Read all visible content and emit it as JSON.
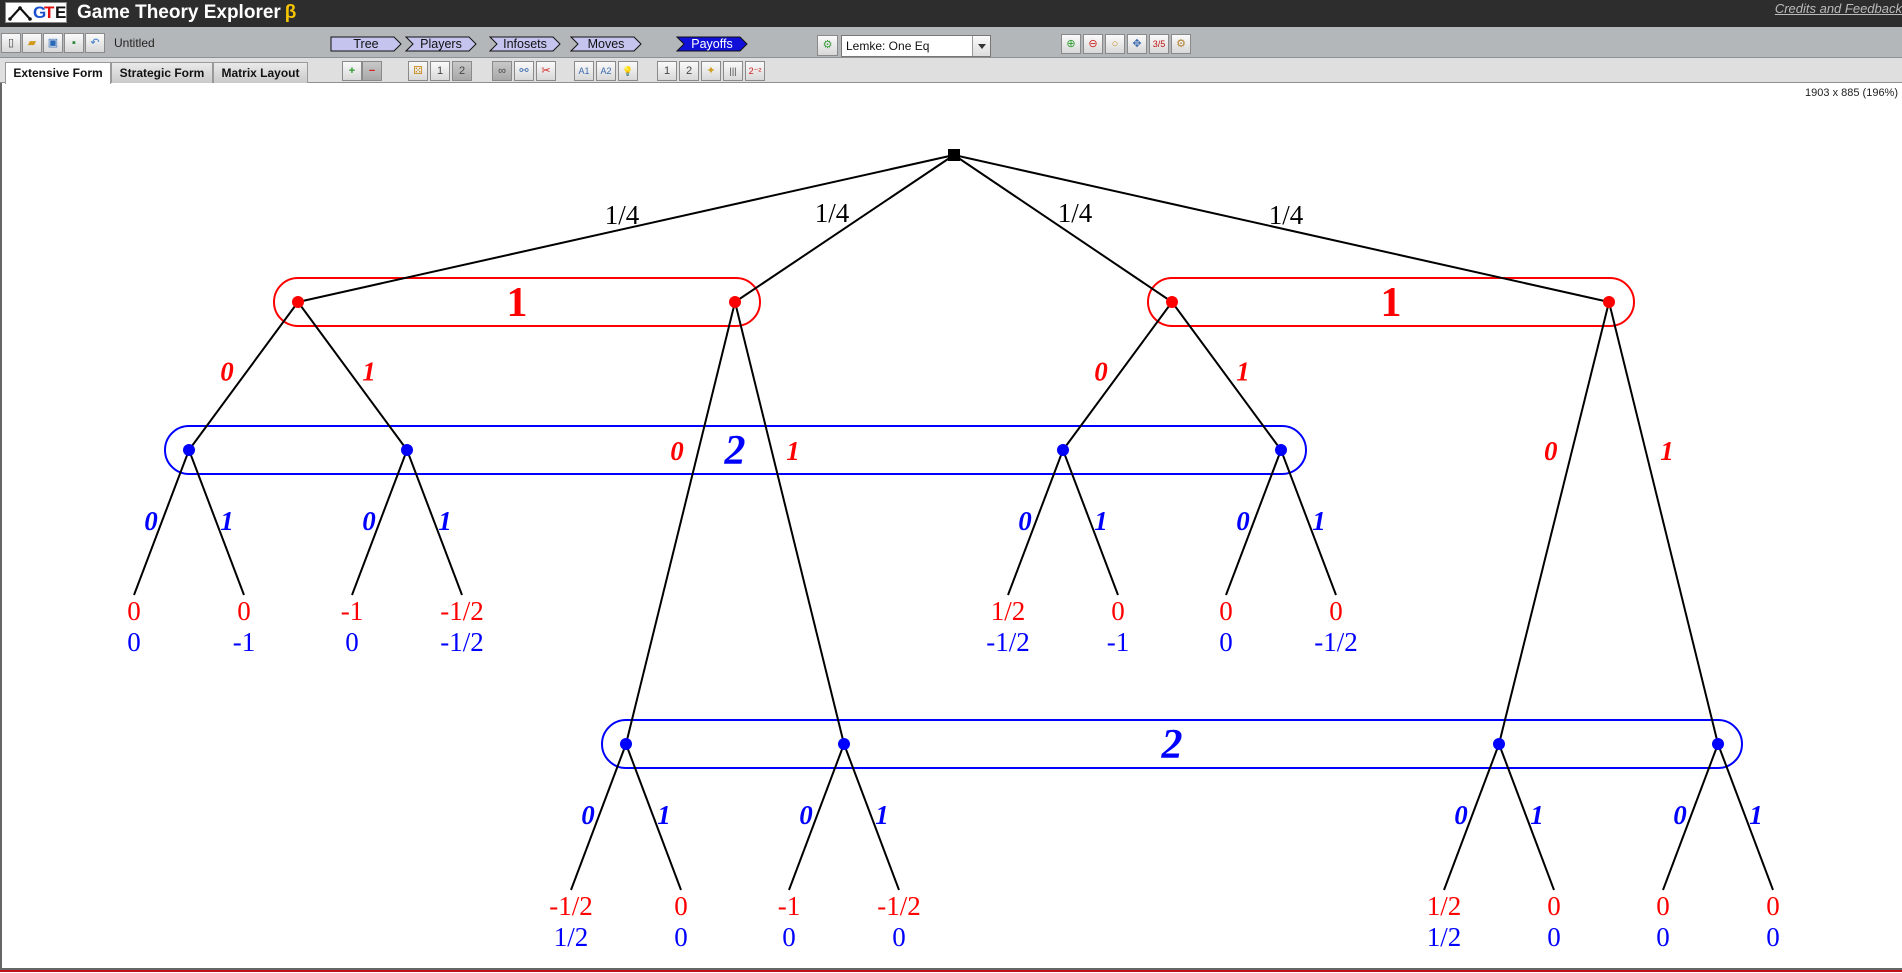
{
  "app": {
    "logo_text": [
      "G",
      "T",
      "E"
    ],
    "title": "Game Theory Explorer",
    "beta_symbol": "β",
    "credits_link": "Credits and Feedback"
  },
  "toolbar": {
    "file_buttons": [
      {
        "name": "new-file-icon",
        "label": "new"
      },
      {
        "name": "open-file-icon",
        "label": "open"
      },
      {
        "name": "save-file-icon",
        "label": "save"
      },
      {
        "name": "export-image-icon",
        "label": "export"
      },
      {
        "name": "print-icon",
        "label": "print"
      }
    ],
    "document_name": "Untitled",
    "steps": [
      "Tree",
      "Players",
      "Infosets",
      "Moves",
      "Payoffs"
    ],
    "active_step": "Payoffs",
    "solver": {
      "selected": "Lemke: One Eq"
    },
    "view_buttons": [
      {
        "name": "zoom-in-icon",
        "glyph": "⊕"
      },
      {
        "name": "zoom-out-icon",
        "glyph": "⊖"
      },
      {
        "name": "zoom-fit-icon",
        "glyph": "○"
      },
      {
        "name": "pan-icon",
        "glyph": "✥"
      },
      {
        "name": "fraction-format-icon",
        "glyph": "3/5"
      },
      {
        "name": "settings-icon",
        "glyph": "⚙"
      }
    ]
  },
  "tabs": [
    "Extensive Form",
    "Strategic Form",
    "Matrix Layout"
  ],
  "active_tab": "Extensive Form",
  "tools": {
    "add_remove": [
      {
        "name": "add-node-icon",
        "glyph": "+"
      },
      {
        "name": "remove-node-icon",
        "glyph": "−"
      }
    ],
    "players": [
      {
        "name": "chance-dice-icon",
        "glyph": "⚄"
      },
      {
        "name": "player-1-icon",
        "glyph": "1"
      },
      {
        "name": "player-2-icon",
        "glyph": "2"
      }
    ],
    "infosets": [
      {
        "name": "link-infoset-icon",
        "glyph": "∞"
      },
      {
        "name": "unlink-infoset-icon",
        "glyph": "⚯"
      },
      {
        "name": "cut-infoset-icon",
        "glyph": "✂"
      }
    ],
    "moves": [
      {
        "name": "auto-label-player1-icon",
        "glyph": "A1"
      },
      {
        "name": "auto-label-player2-icon",
        "glyph": "A2"
      },
      {
        "name": "hint-bulb-icon",
        "glyph": "💡"
      }
    ],
    "payoffs": [
      {
        "name": "payoff-player1-icon",
        "glyph": "1"
      },
      {
        "name": "payoff-player2-icon",
        "glyph": "2"
      },
      {
        "name": "random-payoffs-wand-icon",
        "glyph": "✦"
      },
      {
        "name": "align-payoffs-icon",
        "glyph": "|||"
      },
      {
        "name": "zero-sum-icon",
        "glyph": "2⁻²"
      }
    ]
  },
  "canvas": {
    "size_info": "1903 x 885 (196%)"
  },
  "game_tree": {
    "player_colors": {
      "chance": "#000000",
      "1": "#ff0000",
      "2": "#0000ff"
    },
    "root": {
      "player": "chance"
    },
    "chance_probabilities": [
      "1/4",
      "1/4",
      "1/4",
      "1/4"
    ],
    "infosets": [
      {
        "id": "p1-left",
        "player": "1",
        "label": "1",
        "nodes": [
          "A",
          "B"
        ]
      },
      {
        "id": "p1-right",
        "player": "1",
        "label": "1",
        "nodes": [
          "C",
          "D"
        ]
      },
      {
        "id": "p2-upper",
        "player": "2",
        "label": "2",
        "nodes": [
          "A0",
          "A1",
          "C0",
          "C1"
        ]
      },
      {
        "id": "p2-lower",
        "player": "2",
        "label": "2",
        "nodes": [
          "B0",
          "B1",
          "D0",
          "D1"
        ]
      }
    ],
    "player1_moves": [
      "0",
      "1"
    ],
    "player2_moves": [
      "0",
      "1"
    ],
    "leaves": [
      {
        "path": "A-0-0",
        "p1": "0",
        "p2": "0"
      },
      {
        "path": "A-0-1",
        "p1": "0",
        "p2": "-1"
      },
      {
        "path": "A-1-0",
        "p1": "-1",
        "p2": "0"
      },
      {
        "path": "A-1-1",
        "p1": "-1/2",
        "p2": "-1/2"
      },
      {
        "path": "B-0-0",
        "p1": "-1/2",
        "p2": "1/2"
      },
      {
        "path": "B-0-1",
        "p1": "0",
        "p2": "0"
      },
      {
        "path": "B-1-0",
        "p1": "-1",
        "p2": "0"
      },
      {
        "path": "B-1-1",
        "p1": "-1/2",
        "p2": "0"
      },
      {
        "path": "C-0-0",
        "p1": "1/2",
        "p2": "-1/2"
      },
      {
        "path": "C-0-1",
        "p1": "0",
        "p2": "-1"
      },
      {
        "path": "C-1-0",
        "p1": "0",
        "p2": "0"
      },
      {
        "path": "C-1-1",
        "p1": "0",
        "p2": "-1/2"
      },
      {
        "path": "D-0-0",
        "p1": "1/2",
        "p2": "1/2"
      },
      {
        "path": "D-0-1",
        "p1": "0",
        "p2": "0"
      },
      {
        "path": "D-1-0",
        "p1": "0",
        "p2": "0"
      },
      {
        "path": "D-1-1",
        "p1": "0",
        "p2": "0"
      }
    ]
  }
}
